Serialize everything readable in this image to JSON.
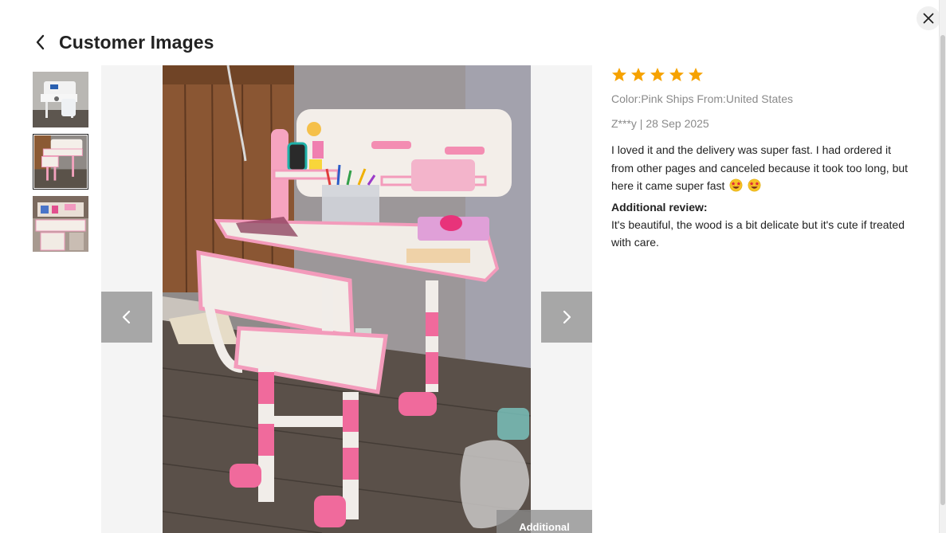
{
  "header": {
    "title": "Customer Images"
  },
  "review": {
    "rating": 5,
    "rating_max": 5,
    "meta_color_shipping": "Color:Pink Ships From:United States",
    "meta_author_date": "Z***y | 28 Sep 2025",
    "text": "I loved it and the delivery was super fast. I had ordered it from other pages and canceled because it took too long, but here it came super fast",
    "emoji": [
      "star-struck-emoji",
      "star-struck-emoji"
    ],
    "additional_label": "Additional review:",
    "additional_text": "It's beautiful, the wood is a bit delicate but it's cute if treated with care."
  },
  "viewer": {
    "overlay_tag": "Additional",
    "selected_thumbnail_index": 1,
    "thumbnail_count": 3
  },
  "colors": {
    "star": "#f6a200",
    "nav_button": "#969696",
    "text_muted": "#8a8a8a",
    "viewer_bg": "#f4f4f4"
  },
  "icons": {
    "back": "chevron-left-icon",
    "close": "close-icon",
    "prev": "chevron-left-icon",
    "next": "chevron-right-icon",
    "star": "star-icon"
  }
}
